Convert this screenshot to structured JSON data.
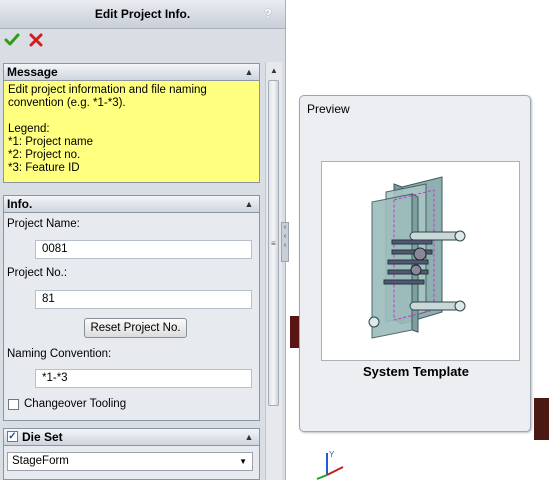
{
  "header": {
    "title": "Edit Project Info.",
    "help": "?"
  },
  "message": {
    "title": "Message",
    "text": "Edit project information and file naming convention (e.g. *1-*3).\n\nLegend:\n*1: Project name\n*2: Project no.\n*3: Feature ID"
  },
  "info": {
    "title": "Info.",
    "project_name_label": "Project Name:",
    "project_name_value": "0081",
    "project_no_label": "Project No.:",
    "project_no_value": "81",
    "reset_button": "Reset Project No.",
    "naming_label": "Naming Convention:",
    "naming_value": "*1-*3",
    "changeover_label": "Changeover Tooling",
    "changeover_checked": false
  },
  "die_set": {
    "title": "Die Set",
    "checked": true,
    "selected": "StageForm"
  },
  "preview": {
    "title": "Preview",
    "caption": "System Template"
  },
  "colors": {
    "message_bg": "#ffff80",
    "ok_green": "#2e9e1a",
    "cancel_red": "#d21e1e"
  }
}
